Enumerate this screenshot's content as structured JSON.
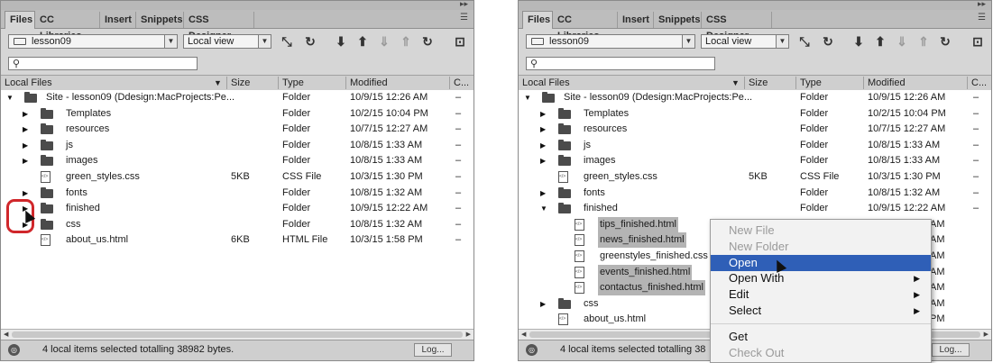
{
  "tabs": [
    "Files",
    "CC Libraries",
    "Insert",
    "Snippets",
    "CSS Designer"
  ],
  "site": "lesson09",
  "view": "Local view",
  "columns": {
    "name": "Local Files",
    "size": "Size",
    "type": "Type",
    "modified": "Modified",
    "checkout": "C..."
  },
  "left_rows": [
    {
      "tri": "▼",
      "icon": "folder",
      "name": "Site - lesson09 (Ddesign:MacProjects:Pe...",
      "size": "",
      "type": "Folder",
      "modified": "10/9/15 12:26 AM",
      "co": "–",
      "indent": 0
    },
    {
      "tri": "▶",
      "icon": "folder",
      "name": "Templates",
      "size": "",
      "type": "Folder",
      "modified": "10/2/15 10:04 PM",
      "co": "–",
      "indent": 1
    },
    {
      "tri": "▶",
      "icon": "folder",
      "name": "resources",
      "size": "",
      "type": "Folder",
      "modified": "10/7/15 12:27 AM",
      "co": "–",
      "indent": 1
    },
    {
      "tri": "▶",
      "icon": "folder",
      "name": "js",
      "size": "",
      "type": "Folder",
      "modified": "10/8/15 1:33 AM",
      "co": "–",
      "indent": 1
    },
    {
      "tri": "▶",
      "icon": "folder",
      "name": "images",
      "size": "",
      "type": "Folder",
      "modified": "10/8/15 1:33 AM",
      "co": "–",
      "indent": 1
    },
    {
      "tri": "",
      "icon": "file",
      "name": "green_styles.css",
      "size": "5KB",
      "type": "CSS File",
      "modified": "10/3/15 1:30 PM",
      "co": "–",
      "indent": 1
    },
    {
      "tri": "▶",
      "icon": "folder",
      "name": "fonts",
      "size": "",
      "type": "Folder",
      "modified": "10/8/15 1:32 AM",
      "co": "–",
      "indent": 1
    },
    {
      "tri": "▶",
      "icon": "folder",
      "name": "finished",
      "size": "",
      "type": "Folder",
      "modified": "10/9/15 12:22 AM",
      "co": "–",
      "indent": 1
    },
    {
      "tri": "▶",
      "icon": "folder",
      "name": "css",
      "size": "",
      "type": "Folder",
      "modified": "10/8/15 1:32 AM",
      "co": "–",
      "indent": 1
    },
    {
      "tri": "",
      "icon": "file",
      "name": "about_us.html",
      "size": "6KB",
      "type": "HTML File",
      "modified": "10/3/15 1:58 PM",
      "co": "–",
      "indent": 1
    }
  ],
  "right_rows": [
    {
      "tri": "▼",
      "icon": "folder",
      "name": "Site - lesson09 (Ddesign:MacProjects:Pe...",
      "size": "",
      "type": "Folder",
      "modified": "10/9/15 12:26 AM",
      "co": "–",
      "indent": 0
    },
    {
      "tri": "▶",
      "icon": "folder",
      "name": "Templates",
      "size": "",
      "type": "Folder",
      "modified": "10/2/15 10:04 PM",
      "co": "–",
      "indent": 1
    },
    {
      "tri": "▶",
      "icon": "folder",
      "name": "resources",
      "size": "",
      "type": "Folder",
      "modified": "10/7/15 12:27 AM",
      "co": "–",
      "indent": 1
    },
    {
      "tri": "▶",
      "icon": "folder",
      "name": "js",
      "size": "",
      "type": "Folder",
      "modified": "10/8/15 1:33 AM",
      "co": "–",
      "indent": 1
    },
    {
      "tri": "▶",
      "icon": "folder",
      "name": "images",
      "size": "",
      "type": "Folder",
      "modified": "10/8/15 1:33 AM",
      "co": "–",
      "indent": 1
    },
    {
      "tri": "",
      "icon": "file",
      "name": "green_styles.css",
      "size": "5KB",
      "type": "CSS File",
      "modified": "10/3/15 1:30 PM",
      "co": "–",
      "indent": 1
    },
    {
      "tri": "▶",
      "icon": "folder",
      "name": "fonts",
      "size": "",
      "type": "Folder",
      "modified": "10/8/15 1:32 AM",
      "co": "–",
      "indent": 1
    },
    {
      "tri": "▼",
      "icon": "folder",
      "name": "finished",
      "size": "",
      "type": "Folder",
      "modified": "10/9/15 12:22 AM",
      "co": "–",
      "indent": 1
    },
    {
      "tri": "",
      "icon": "file",
      "name": "tips_finished.html",
      "size": "",
      "type": "",
      "modified": "AM",
      "co": "",
      "indent": 2,
      "sel": true
    },
    {
      "tri": "",
      "icon": "file",
      "name": "news_finished.html",
      "size": "",
      "type": "",
      "modified": "AM",
      "co": "",
      "indent": 2,
      "sel": true
    },
    {
      "tri": "",
      "icon": "file",
      "name": "greenstyles_finished.css",
      "size": "",
      "type": "",
      "modified": "AM",
      "co": "",
      "indent": 2
    },
    {
      "tri": "",
      "icon": "file",
      "name": "events_finished.html",
      "size": "",
      "type": "",
      "modified": "AM",
      "co": "",
      "indent": 2,
      "sel": true
    },
    {
      "tri": "",
      "icon": "file",
      "name": "contactus_finished.html",
      "size": "",
      "type": "",
      "modified": "AM",
      "co": "",
      "indent": 2,
      "sel": true
    },
    {
      "tri": "▶",
      "icon": "folder",
      "name": "css",
      "size": "",
      "type": "",
      "modified": "AM",
      "co": "",
      "indent": 1
    },
    {
      "tri": "",
      "icon": "file",
      "name": "about_us.html",
      "size": "",
      "type": "",
      "modified": "PM",
      "co": "",
      "indent": 1
    }
  ],
  "status_left": "4 local items selected totalling 38982 bytes.",
  "status_right": "4 local items selected totalling 38",
  "log_label": "Log...",
  "context_menu": {
    "items": [
      {
        "label": "New File",
        "disabled": true
      },
      {
        "label": "New Folder",
        "disabled": true
      },
      {
        "label": "Open",
        "highlight": true
      },
      {
        "label": "Open With",
        "submenu": true
      },
      {
        "label": "Edit",
        "submenu": true
      },
      {
        "label": "Select",
        "submenu": true
      },
      {
        "sep": true
      },
      {
        "label": "Get"
      },
      {
        "label": "Check Out",
        "disabled": true
      }
    ]
  },
  "colors": {
    "highlight": "#2f5fb7",
    "callout": "#d0272b",
    "selection": "#b4b4b4"
  }
}
